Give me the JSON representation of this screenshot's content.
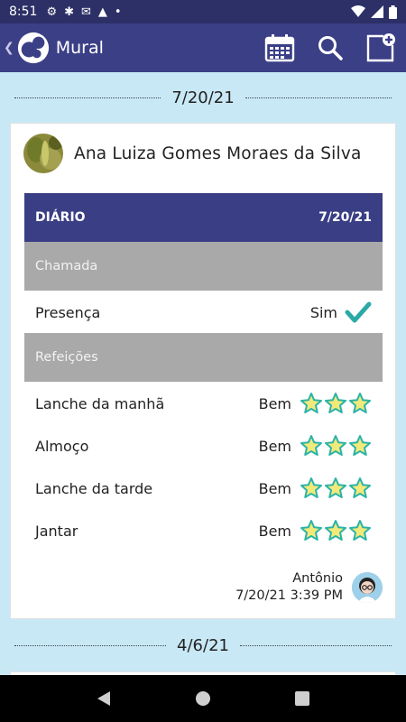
{
  "status": {
    "time": "8:51"
  },
  "app": {
    "title": "Mural"
  },
  "feed": [
    {
      "date": "7/20/21"
    },
    {
      "date": "4/6/21"
    }
  ],
  "entry": {
    "student_name": "Ana Luiza Gomes Moraes da Silva",
    "diary": {
      "title": "DIÁRIO",
      "date": "7/20/21"
    },
    "sections": [
      {
        "label": "Chamada"
      },
      {
        "label": "Refeições"
      }
    ],
    "attendance": {
      "label": "Presença",
      "value": "Sim"
    },
    "meals": [
      {
        "label": "Lanche da manhã",
        "value": "Bem",
        "rating": 3
      },
      {
        "label": "Almoço",
        "value": "Bem",
        "rating": 3
      },
      {
        "label": "Lanche da tarde",
        "value": "Bem",
        "rating": 3
      },
      {
        "label": "Jantar",
        "value": "Bem",
        "rating": 3
      }
    ],
    "author": {
      "name": "Antônio",
      "timestamp": "7/20/21 3:39 PM"
    }
  },
  "colors": {
    "header": "#3b3f86",
    "diary_bar": "#3a3e84",
    "section_bar": "#a9a9a9",
    "check": "#2aa9a6",
    "star_fill": "#f1ea7a",
    "star_stroke": "#2bb3a7"
  },
  "icons": [
    "gear-icon",
    "accessibility-icon",
    "gmail-icon",
    "drive-icon",
    "wifi-icon",
    "signal-icon",
    "battery-icon",
    "calendar-icon",
    "search-icon",
    "new-post-icon",
    "check-icon",
    "star-icon"
  ]
}
